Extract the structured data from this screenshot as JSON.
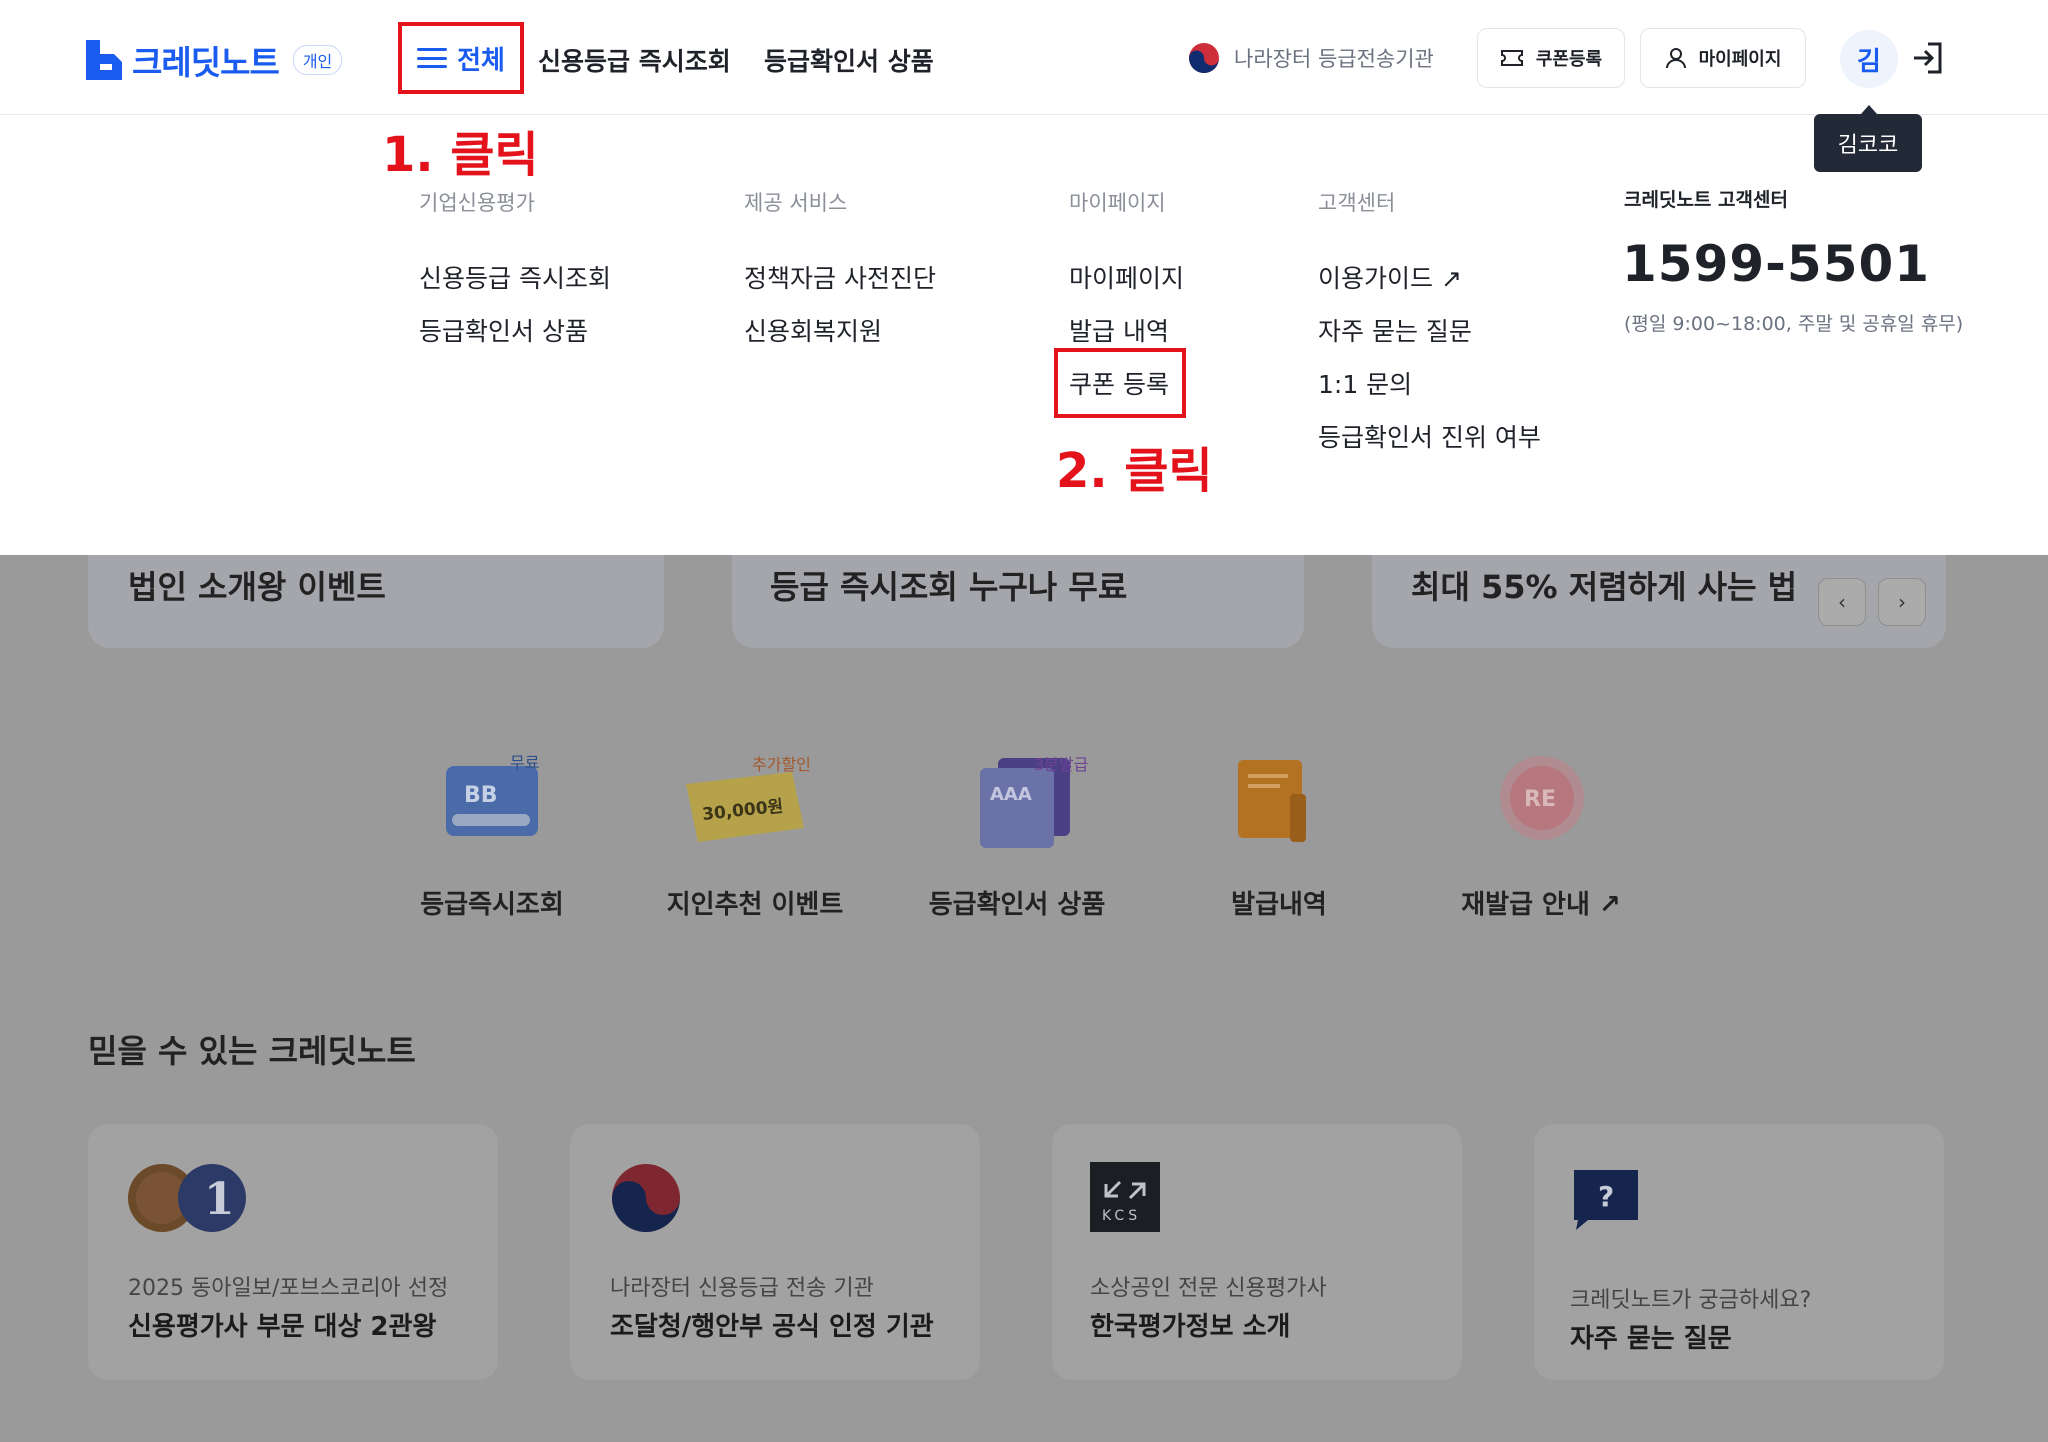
{
  "header": {
    "logo_text": "크레딧노트",
    "logo_badge": "개인",
    "nav_all": "전체",
    "nav_links": [
      "신용등급 즉시조회",
      "등급확인서 상품"
    ],
    "gov_label": "나라장터 등급전송기관",
    "coupon_button": "쿠폰등록",
    "mypage_button": "마이페이지",
    "avatar_initial": "김",
    "tooltip_name": "김코코"
  },
  "annotations": {
    "step1": "1. 클릭",
    "step2": "2. 클릭"
  },
  "menu": {
    "columns": [
      {
        "title": "기업신용평가",
        "items": [
          "신용등급 즉시조회",
          "등급확인서 상품"
        ]
      },
      {
        "title": "제공 서비스",
        "items": [
          "정책자금 사전진단",
          "신용회복지원"
        ]
      },
      {
        "title": "마이페이지",
        "items": [
          "마이페이지",
          "발급 내역",
          "쿠폰 등록"
        ]
      },
      {
        "title": "고객센터",
        "items": [
          "이용가이드 ↗",
          "자주 묻는 질문",
          "1:1 문의",
          "등급확인서 진위 여부"
        ]
      }
    ],
    "customer_center": {
      "title": "크레딧노트 고객센터",
      "phone": "1599-5501",
      "hours": "(평일 9:00~18:00, 주말 및 공휴일 휴무)"
    }
  },
  "banners": [
    {
      "title": "법인 소개왕 이벤트"
    },
    {
      "title": "등급 즉시조회 누구나 무료"
    },
    {
      "title": "최대 55% 저렴하게 사는 법"
    }
  ],
  "carousel": {
    "prev": "‹",
    "next": "›"
  },
  "quick_menu": [
    {
      "label": "등급즉시조회",
      "icon_text": "BB",
      "badge": "무료",
      "icon": "credit-card-icon"
    },
    {
      "label": "지인추천 이벤트",
      "icon_text": "30,000원",
      "badge": "추가할인",
      "icon": "ticket-icon"
    },
    {
      "label": "등급확인서 상품",
      "icon_text": "AAA",
      "badge": "3분발급",
      "icon": "document-stack-icon"
    },
    {
      "label": "발급내역",
      "icon_text": "",
      "badge": "",
      "icon": "receipt-icon"
    },
    {
      "label": "재발급 안내 ↗",
      "icon_text": "RE",
      "badge": "",
      "icon": "reissue-icon"
    }
  ],
  "trust_section": {
    "title": "믿을 수 있는 크레딧노트",
    "cards": [
      {
        "sub": "2025 동아일보/포브스코리아 선정",
        "title": "신용평가사 부문 대상 2관왕",
        "icon": "award-medal-icon"
      },
      {
        "sub": "나라장터 신용등급 전송 기관",
        "title": "조달청/행안부 공식 인정 기관",
        "icon": "korea-emblem-icon"
      },
      {
        "sub": "소상공인 전문 신용평가사",
        "title": "한국평가정보 소개",
        "icon": "kcs-logo-icon",
        "icon_text": "KCS"
      },
      {
        "sub": "크레딧노트가 궁금하세요?",
        "title": "자주 묻는 질문",
        "icon": "question-bubble-icon",
        "icon_text": "?"
      }
    ]
  },
  "colors": {
    "brand": "#1a5cf0",
    "annotation": "#e3121b",
    "overlay": "#9a9a9a"
  }
}
